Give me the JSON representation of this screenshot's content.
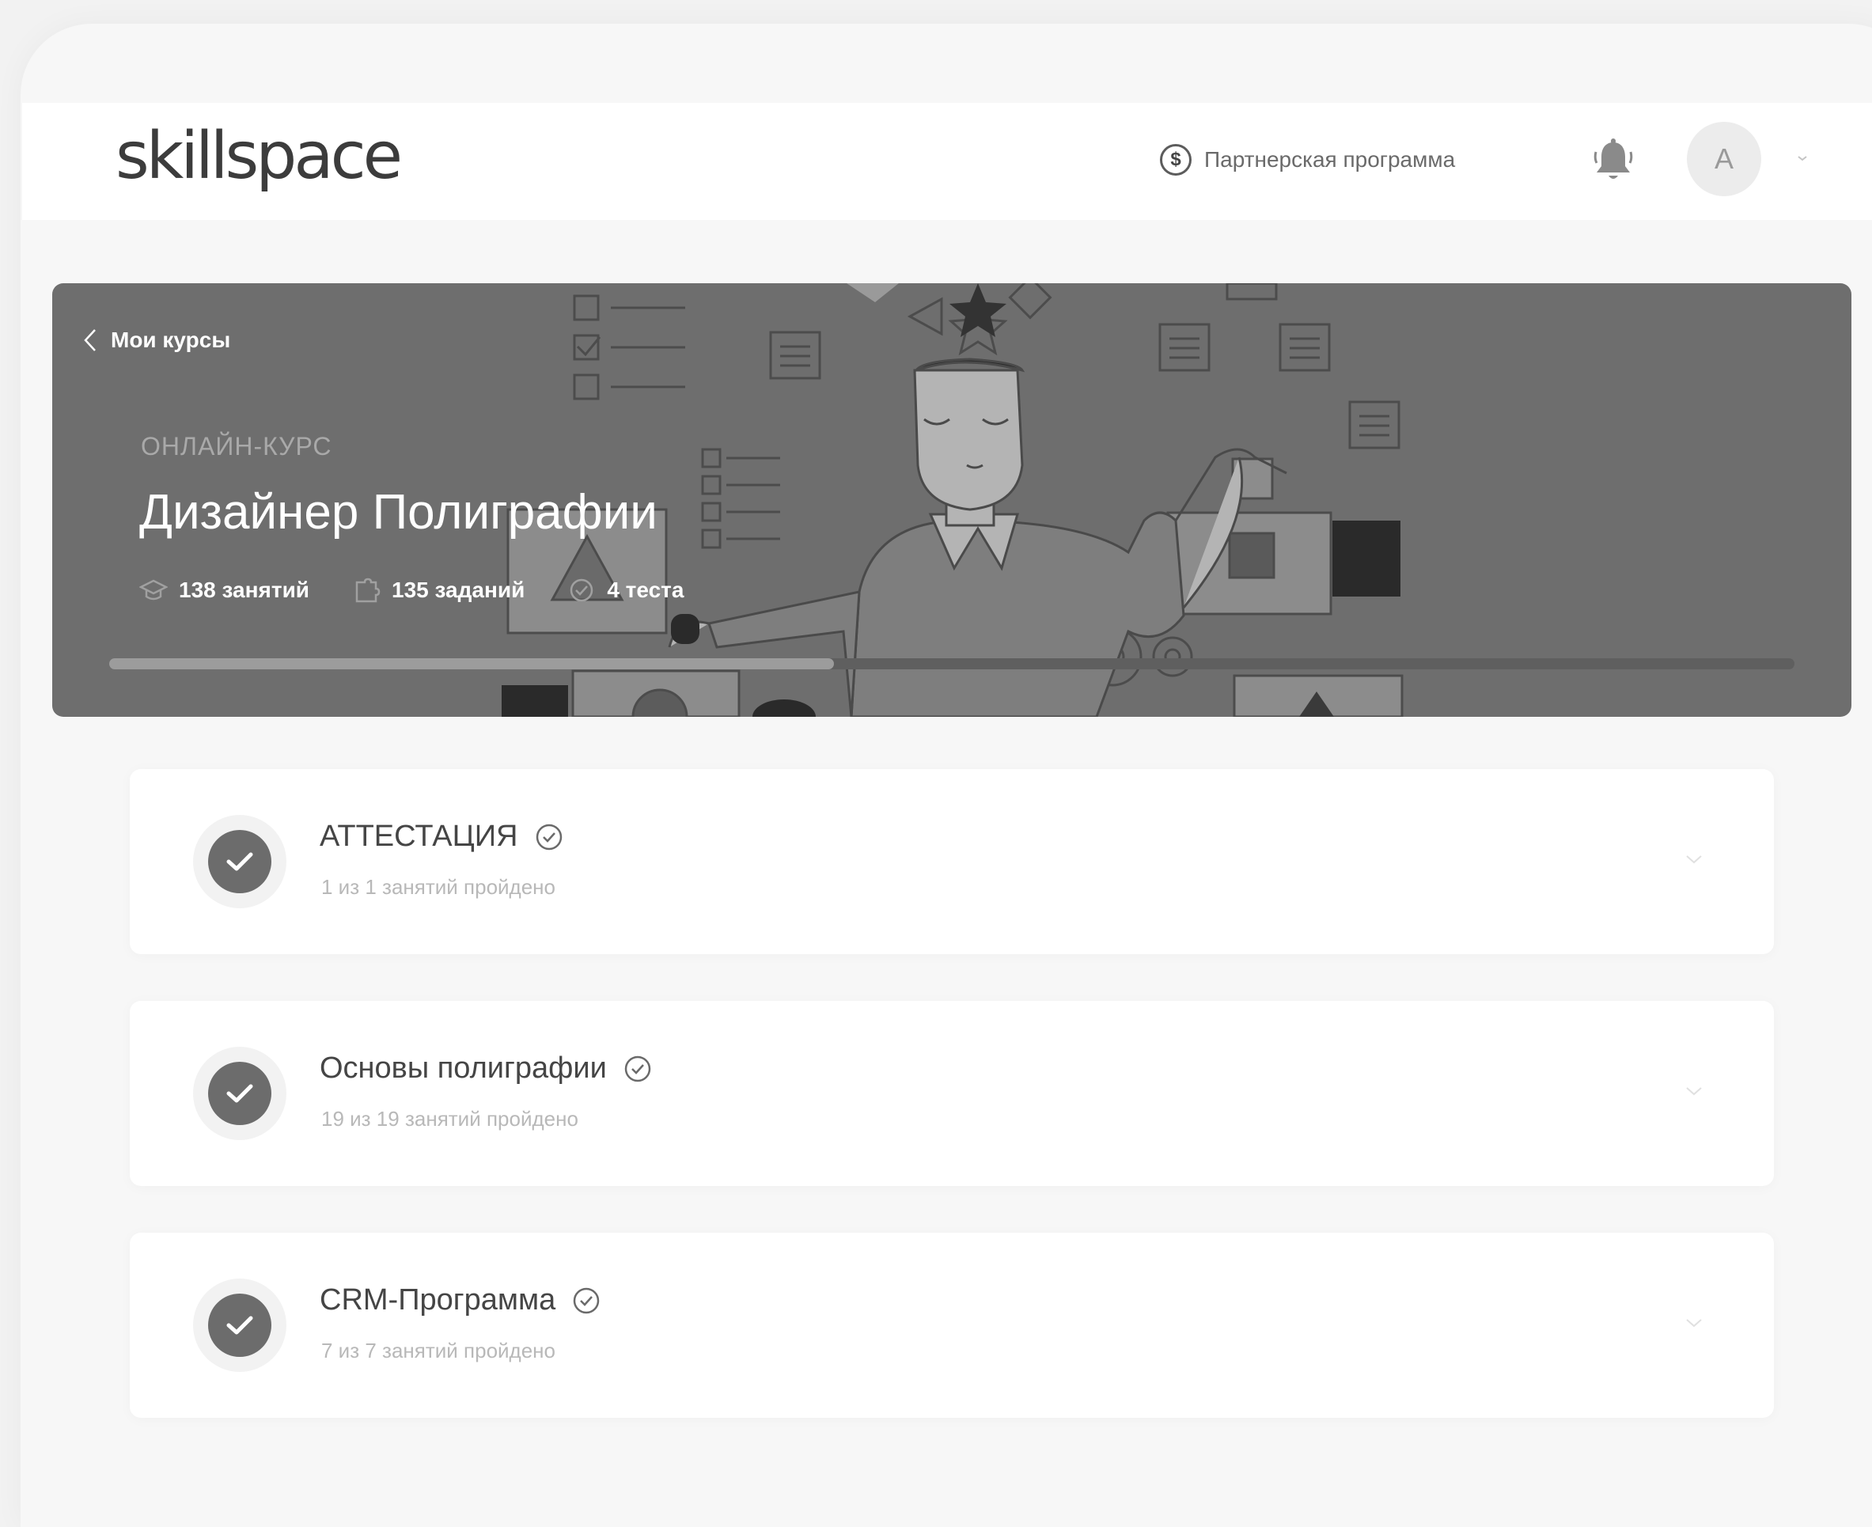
{
  "header": {
    "logo": "skillspace",
    "partner_label": "Партнерская программа",
    "avatar_initial": "A"
  },
  "banner": {
    "back_label": "Мои курсы",
    "overline": "ОНЛАЙН-КУРС",
    "title": "Дизайнер Полиграфии",
    "stats": {
      "lessons": "138 занятий",
      "tasks": "135 заданий",
      "tests": "4 теста"
    },
    "progress_fraction": 0.43
  },
  "modules": [
    {
      "title": "АТТЕСТАЦИЯ",
      "subtitle": "1 из 1 занятий пройдено"
    },
    {
      "title": "Основы полиграфии",
      "subtitle": "19 из 19 занятий пройдено"
    },
    {
      "title": "CRM-Программа",
      "subtitle": "7 из 7 занятий пройдено"
    }
  ]
}
